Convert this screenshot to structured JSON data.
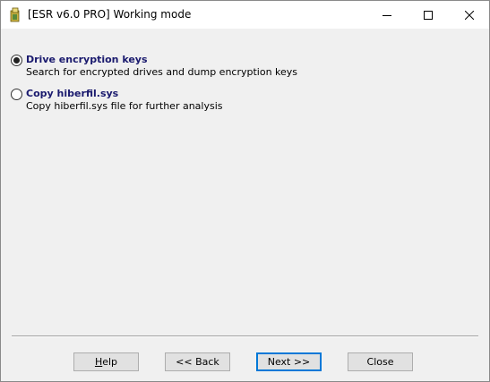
{
  "window": {
    "title": "[ESR v6.0 PRO]  Working mode",
    "icon": "app-icon",
    "controls": [
      "minimize-icon",
      "maximize-icon",
      "close-icon"
    ]
  },
  "options": [
    {
      "title": "Drive encryption keys",
      "description": "Search for encrypted drives and dump encryption keys",
      "selected": true
    },
    {
      "title": "Copy hiberfil.sys",
      "description": "Copy hiberfil.sys file for further analysis",
      "selected": false
    }
  ],
  "buttons": {
    "help_first": "H",
    "help_rest": "elp",
    "back": "<< Back",
    "next": "Next >>",
    "close": "Close"
  },
  "colors": {
    "option_title": "#1a1a6e",
    "default_button_border": "#0078d7",
    "dialog_background": "#f0f0f0"
  }
}
